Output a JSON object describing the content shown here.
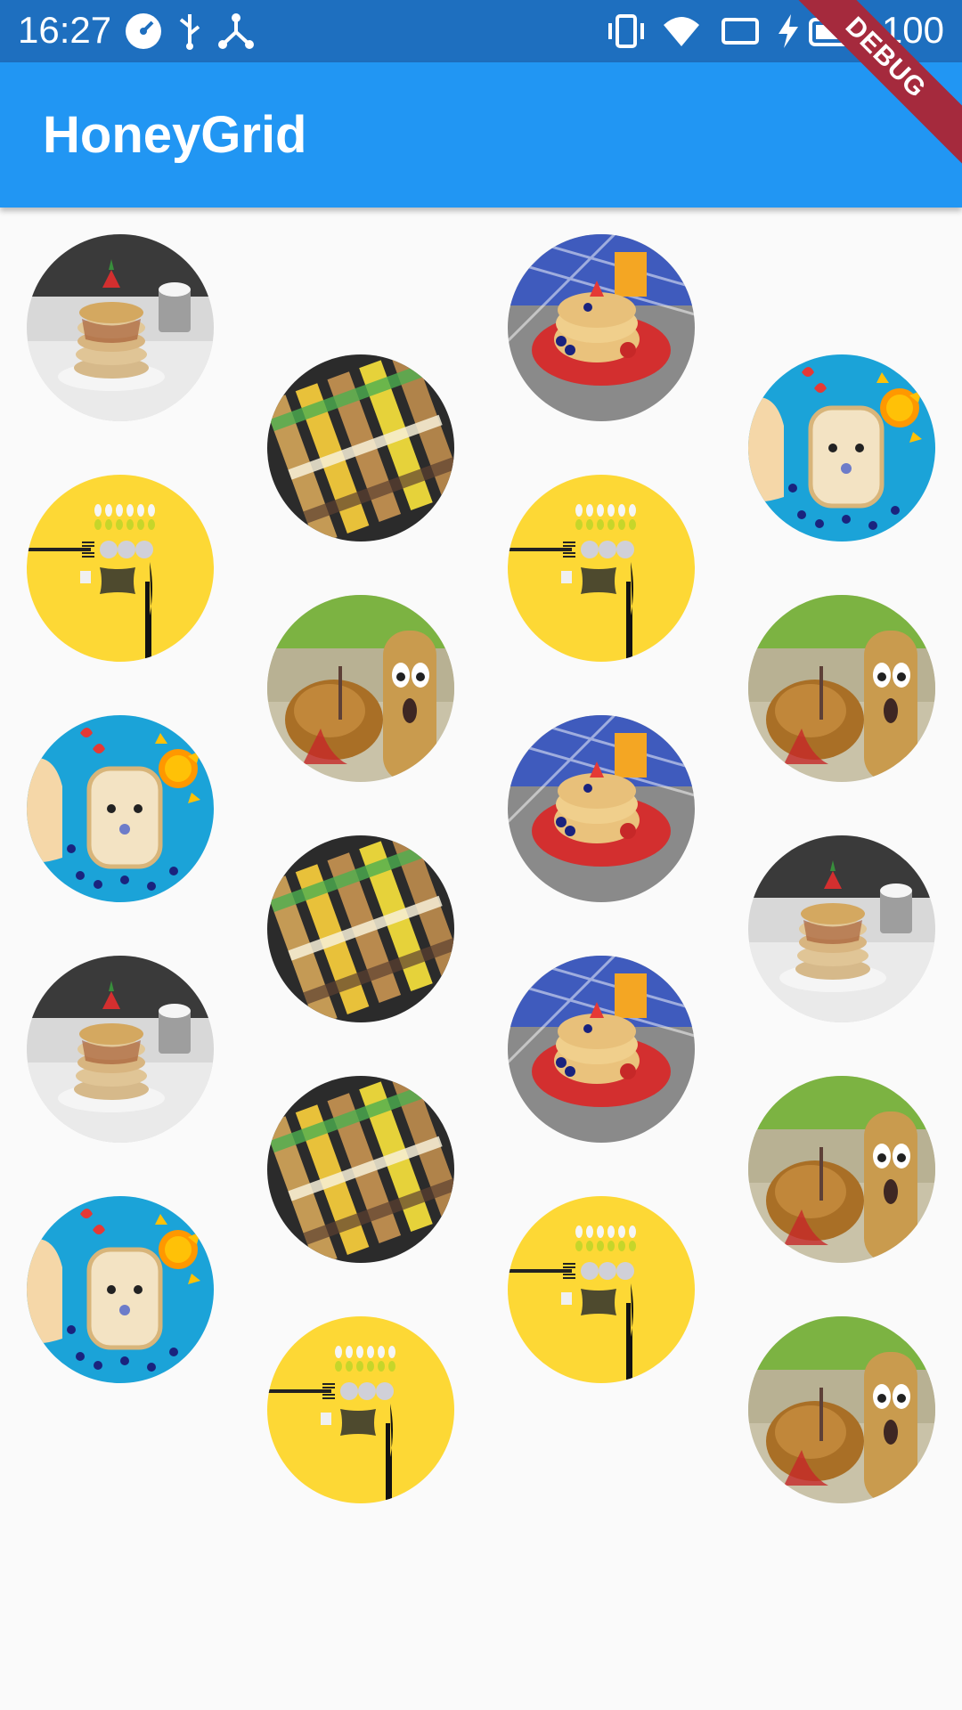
{
  "status_bar": {
    "time": "16:27",
    "battery": "100",
    "icons": [
      "speedometer-icon",
      "usb-icon",
      "network-icon",
      "vibrate-icon",
      "wifi-icon",
      "cast-icon",
      "charging-icon",
      "battery-icon"
    ]
  },
  "app_bar": {
    "title": "HoneyGrid"
  },
  "debug_banner": {
    "label": "DEBUG"
  },
  "grid": {
    "columns": 4,
    "tiles": [
      {
        "image": "pancake-stack"
      },
      {
        "image": "kebab-skewers"
      },
      {
        "image": "waffles-plate"
      },
      {
        "image": "bread-face"
      },
      {
        "image": "yellow-cutlery"
      },
      {
        "image": "potato-characters"
      },
      {
        "image": "yellow-cutlery"
      },
      {
        "image": "potato-characters"
      },
      {
        "image": "bread-face"
      },
      {
        "image": "kebab-skewers"
      },
      {
        "image": "waffles-plate"
      },
      {
        "image": "pancake-stack"
      },
      {
        "image": "pancake-stack"
      },
      {
        "image": "kebab-skewers"
      },
      {
        "image": "waffles-plate"
      },
      {
        "image": "potato-characters"
      },
      {
        "image": "bread-face"
      },
      {
        "image": "yellow-cutlery"
      },
      {
        "image": "yellow-cutlery"
      },
      {
        "image": "potato-characters"
      }
    ]
  }
}
